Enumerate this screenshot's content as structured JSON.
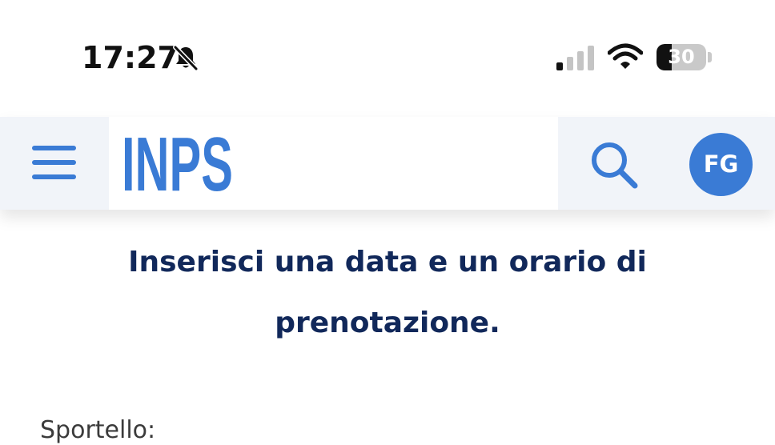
{
  "status_bar": {
    "time": "17:27",
    "battery_level": "30",
    "battery_fraction": 0.3,
    "icons": [
      "bell-muted-icon",
      "cellular-signal-icon",
      "wifi-icon",
      "battery-icon"
    ]
  },
  "header": {
    "logo_text": "INPS",
    "avatar_initials": "FG",
    "icons": [
      "hamburger-menu-icon",
      "search-icon"
    ]
  },
  "main": {
    "heading": "Inserisci una data e un orario di prenotazione.",
    "field_label": "Sportello:"
  },
  "colors": {
    "brand_blue": "#3a7bd5",
    "heading_navy": "#11285a",
    "header_bg": "#f1f4f9",
    "label_gray": "#3b3b3b"
  }
}
